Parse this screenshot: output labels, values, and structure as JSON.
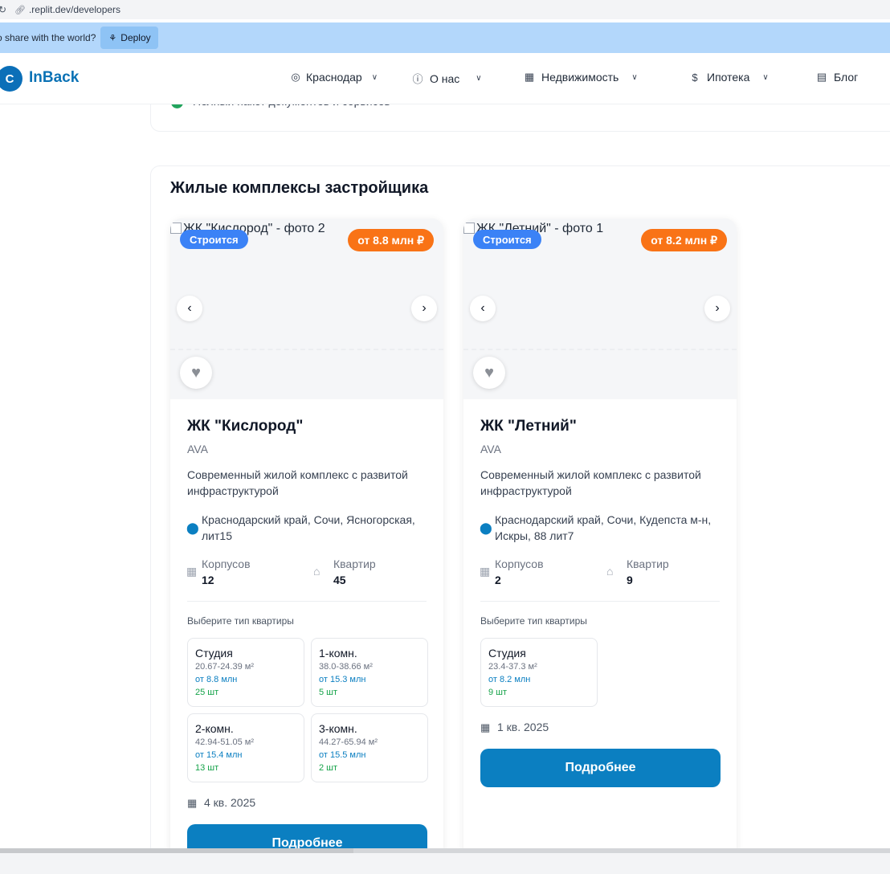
{
  "browser": {
    "url": ".replit.dev/developers"
  },
  "banner": {
    "text": "o share with the world?",
    "deploy_label": "Deploy"
  },
  "header": {
    "logo_letter": "C",
    "logo_text": "InBack",
    "nav": [
      {
        "label": "Краснодар",
        "icon": "location-pin-icon"
      },
      {
        "label": "О нас",
        "icon": "info-icon"
      },
      {
        "label": "Недвижимость",
        "icon": "building-icon"
      },
      {
        "label": "Ипотека",
        "icon": "dollar-icon"
      },
      {
        "label": "Блог",
        "icon": "newspaper-icon"
      }
    ]
  },
  "prev_section": {
    "item_text": "Полный пакет документов и сервисов"
  },
  "section": {
    "title": "Жилые комплексы застройщика"
  },
  "cards": [
    {
      "photo_alt": "ЖК \"Кислород\" - фото 2",
      "status": "Строится",
      "price_badge": "от 8.8 млн ₽",
      "name": "ЖК \"Кислород\"",
      "developer": "AVA",
      "description": "Современный жилой комплекс с развитой инфраструктурой",
      "address": "Краснодарский край, Сочи, Ясногорская, лит15",
      "buildings_label": "Корпусов",
      "buildings_value": "12",
      "apartments_label": "Квартир",
      "apartments_value": "45",
      "choose_label": "Выберите тип квартиры",
      "apartment_types": [
        {
          "title": "Студия",
          "area": "20.67-24.39 м²",
          "price": "от 8.8 млн",
          "count": "25 шт"
        },
        {
          "title": "1-комн.",
          "area": "38.0-38.66 м²",
          "price": "от 15.3 млн",
          "count": "5 шт"
        },
        {
          "title": "2-комн.",
          "area": "42.94-51.05 м²",
          "price": "от 15.4 млн",
          "count": "13 шт"
        },
        {
          "title": "3-комн.",
          "area": "44.27-65.94 м²",
          "price": "от 15.5 млн",
          "count": "2 шт"
        }
      ],
      "completion": "4 кв. 2025",
      "button_label": "Подробнее"
    },
    {
      "photo_alt": "ЖК \"Летний\" - фото 1",
      "status": "Строится",
      "price_badge": "от 8.2 млн ₽",
      "name": "ЖК \"Летний\"",
      "developer": "AVA",
      "description": "Современный жилой комплекс с развитой инфраструктурой",
      "address": "Краснодарский край, Сочи, Кудепста м-н, Искры, 88 лит7",
      "buildings_label": "Корпусов",
      "buildings_value": "2",
      "apartments_label": "Квартир",
      "apartments_value": "9",
      "choose_label": "Выберите тип квартиры",
      "apartment_types": [
        {
          "title": "Студия",
          "area": "23.4-37.3 м²",
          "price": "от 8.2 млн",
          "count": "9 шт"
        }
      ],
      "completion": "1 кв. 2025",
      "button_label": "Подробнее"
    }
  ],
  "colors": {
    "brand": "#0b7fc1",
    "status_badge": "#3b82f6",
    "price_badge": "#f97316",
    "count_green": "#16a34a"
  }
}
